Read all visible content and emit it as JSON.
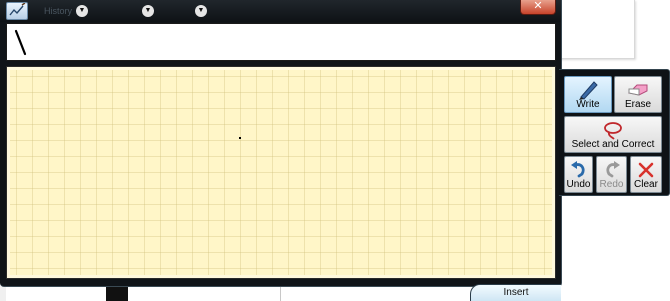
{
  "window": {
    "title_menus": [
      {
        "label": "History"
      },
      {
        "label": ""
      },
      {
        "label": ""
      }
    ],
    "close_glyph": "✕"
  },
  "input": {
    "value": ""
  },
  "tools": {
    "write": {
      "label": "Write",
      "icon": "pen-icon",
      "active": true
    },
    "erase": {
      "label": "Erase",
      "icon": "eraser-icon"
    },
    "select_correct": {
      "label": "Select and Correct",
      "icon": "lasso-icon"
    },
    "undo": {
      "label": "Undo",
      "icon": "undo-arrow-icon"
    },
    "redo": {
      "label": "Redo",
      "icon": "redo-arrow-icon",
      "disabled": true
    },
    "clear": {
      "label": "Clear",
      "icon": "clear-x-icon"
    }
  },
  "insert_label": "Insert",
  "colors": {
    "pad_background": "#fff6c8",
    "frame": "#101418",
    "close_button": "#c7432a",
    "active_tool": "#b2d8f2"
  }
}
